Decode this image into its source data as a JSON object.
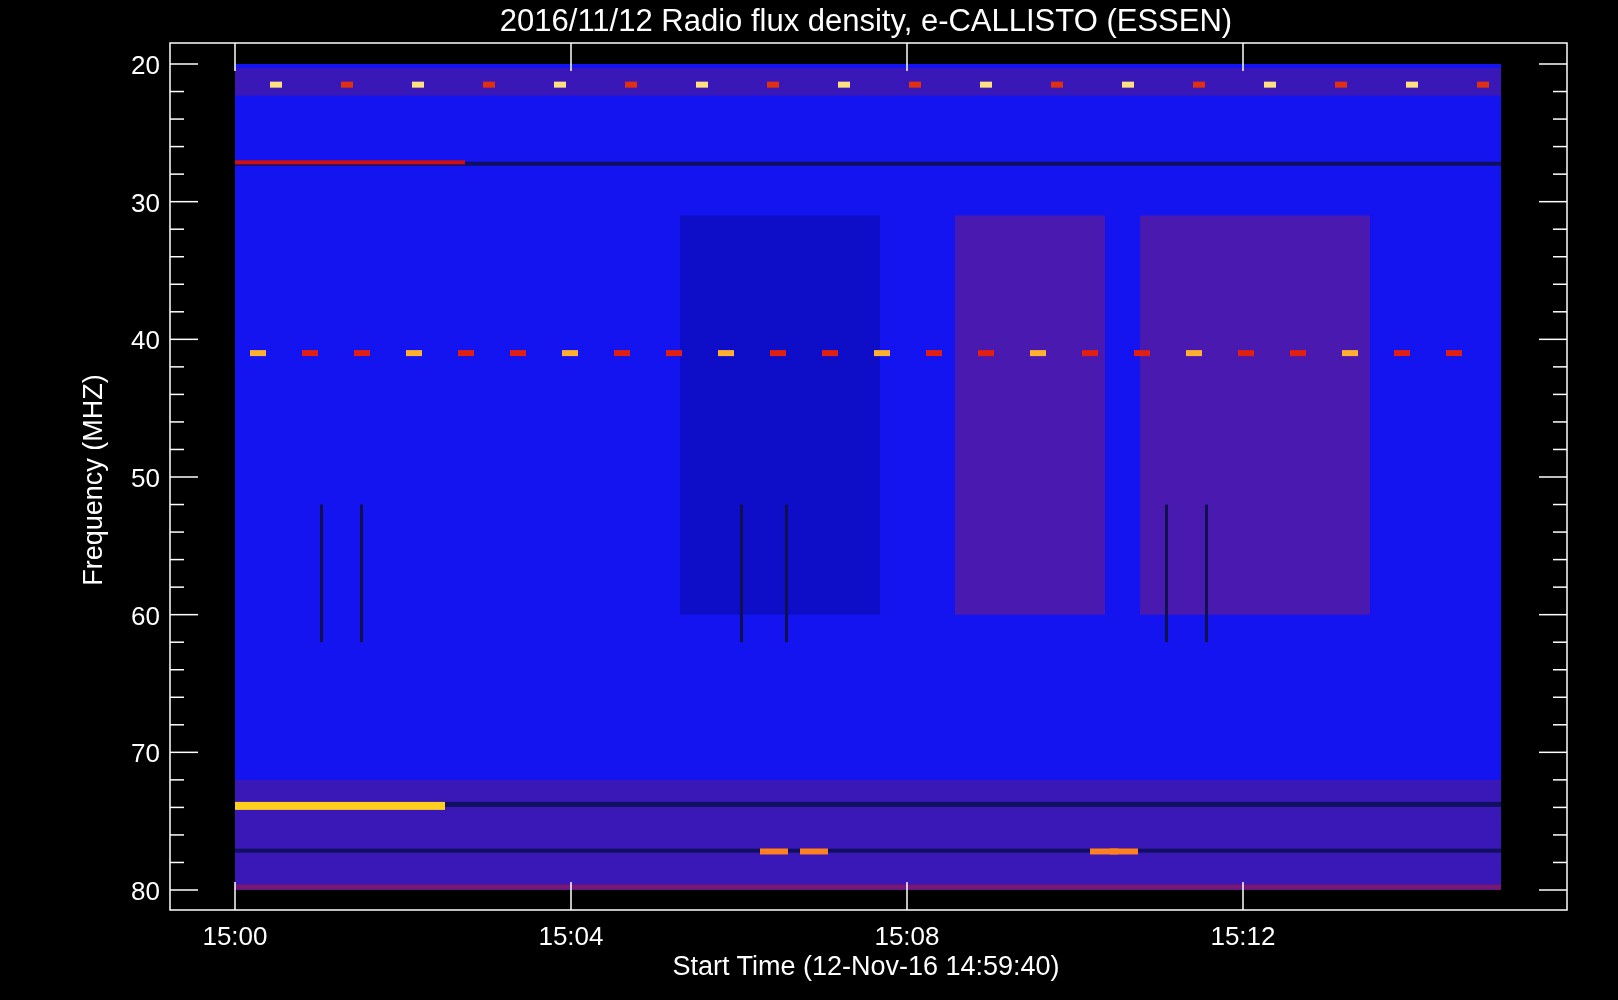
{
  "plot": {
    "title": "2016/11/12  Radio flux density, e-CALLISTO (ESSEN)",
    "ylabel": "Frequency (MHZ)",
    "xlabel": "Start Time (12-Nov-16 14:59:40)",
    "y_tick_labels": [
      "20",
      "30",
      "40",
      "50",
      "60",
      "70",
      "80"
    ],
    "x_tick_labels": [
      "15:00",
      "15:04",
      "15:08",
      "15:12"
    ]
  }
}
